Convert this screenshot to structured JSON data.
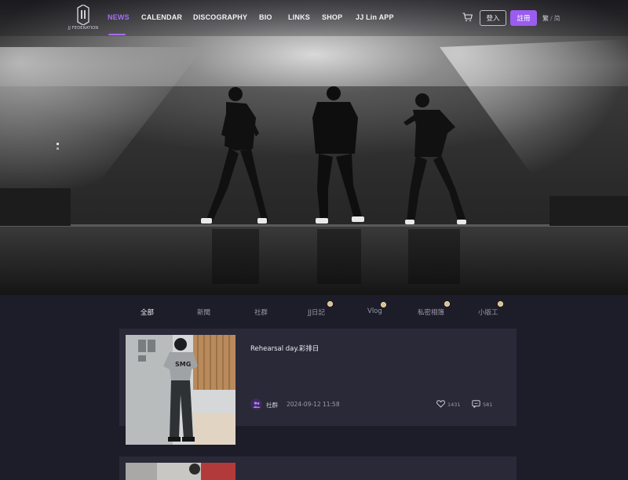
{
  "brand": {
    "logo_text": "JJ FEDERATION"
  },
  "nav": {
    "items": [
      {
        "label": "NEWS",
        "active": true
      },
      {
        "label": "CALENDAR"
      },
      {
        "label": "DISCOGRAPHY"
      },
      {
        "label": "BIO"
      },
      {
        "label": "LINKS"
      },
      {
        "label": "SHOP"
      },
      {
        "label": "JJ Lin APP"
      }
    ],
    "cart_icon": "cart-icon",
    "login_label": "登入",
    "register_label": "註冊",
    "lang_traditional": "繁",
    "lang_separator": "/",
    "lang_simplified": "简"
  },
  "tabs": [
    {
      "label": "全部",
      "active": true,
      "dot": false
    },
    {
      "label": "新聞",
      "dot": false
    },
    {
      "label": "社群",
      "dot": false
    },
    {
      "label": "JJ日記",
      "dot": true
    },
    {
      "label": "Vlog",
      "dot": true
    },
    {
      "label": "私密相簿",
      "dot": true
    },
    {
      "label": "小版工",
      "dot": true
    }
  ],
  "posts": [
    {
      "title": "Rehearsal day.彩排日",
      "author": "社群",
      "date": "2024-09-12 11:58",
      "likes": "1431",
      "comments": "581"
    }
  ],
  "colors": {
    "accent": "#a66cf5",
    "card_bg": "#2a2938",
    "page_bg": "#1d1c29",
    "badge_dot": "#d8c08a"
  }
}
